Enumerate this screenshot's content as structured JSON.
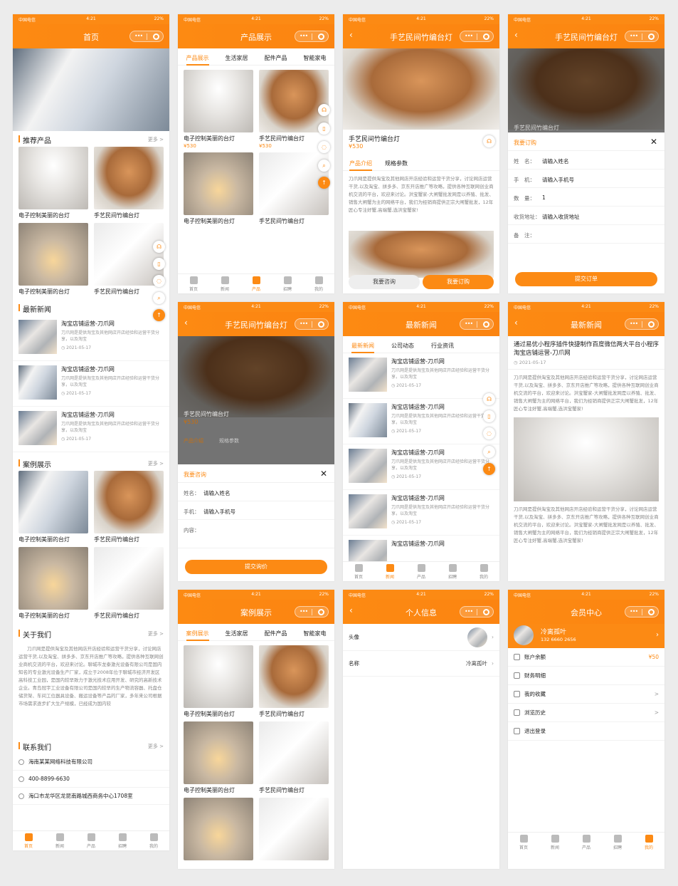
{
  "status": {
    "carrier": "中国电信",
    "time": "4:21",
    "battery": "22%"
  },
  "home": {
    "title": "首页",
    "sec_products": "推荐产品",
    "sec_news": "最新新闻",
    "sec_cases": "案例展示",
    "sec_about": "关于我们",
    "sec_contact": "联系我们",
    "more": "更多 >",
    "products": [
      "电子控制美丽的台灯",
      "手艺民间竹编台灯",
      "电子控制美丽的台灯",
      "手艺民间竹编台灯"
    ],
    "news": [
      {
        "title": "淘宝店铺运营-刀爪网",
        "desc": "刀爪网是提供淘宝及其他网店开店经验和运营干货分享，以及淘宝",
        "date": "2021-05-17"
      },
      {
        "title": "淘宝店铺运营-刀爪网",
        "desc": "刀爪网是提供淘宝及其他网店开店经验和运营干货分享，以及淘宝",
        "date": "2021-05-17"
      },
      {
        "title": "淘宝店铺运营-刀爪网",
        "desc": "刀爪网是提供淘宝及其他网店开店经验和运营干货分享，以及淘宝",
        "date": "2021-05-17"
      }
    ],
    "cases": [
      "电子控制美丽的台灯",
      "手艺民间竹编台灯",
      "电子控制美丽的台灯",
      "手艺民间竹编台灯"
    ],
    "about": "刀爪网是提供淘宝及其他网店开店经验和运营干货分享，讨论网店运营干货,以及淘宝、拼多多、京东开店推广等攻略，提供各种互联网创业商机交流的平台，欢迎来讨论。聊城市龙泰激光设备有限公司是国内知名的专业激光设备生产厂家，成立于2008年位于聊城市经济开发区高科技工业园，是国内较早致力于激光技术应用开发、研究的高新技术企业。青岛冠宇工业设备有限公司是国内较早的生产物流容器、托盘仓储货架、车间工位器具设备、搬运设备等产品的厂家，多年来公司根据市场需求逐步扩大生产规模，已经成为国内较",
    "company": "海南某某网络科技有限公司",
    "phone": "400-8899-6630",
    "address": "海口市龙华区龙昆南路城西商务中心1708室"
  },
  "tabbar": [
    "首页",
    "新闻",
    "产品",
    "招聘",
    "我的"
  ],
  "products_page": {
    "title": "产品展示",
    "tabs": [
      "产品展示",
      "生活家居",
      "配件产品",
      "智能家电"
    ],
    "items": [
      {
        "name": "电子控制美丽的台灯",
        "price": "¥530"
      },
      {
        "name": "手艺民间竹编台灯",
        "price": "¥530"
      },
      {
        "name": "电子控制美丽的台灯",
        "price": ""
      },
      {
        "name": "手艺民间竹编台灯",
        "price": ""
      }
    ]
  },
  "detail": {
    "title": "手艺民间竹编台灯",
    "name": "手艺民间竹编台灯",
    "price": "¥530",
    "tabs": [
      "产品介绍",
      "规格参数"
    ],
    "desc": "刀爪网是提供淘宝及其他网店开店经验和运营干货分享，讨论网店运营干货,以及淘宝、拼多多、京东开店推广等攻略，提供各种互联网创业商机交流的平台，欢迎来讨论。洪宝蟹家-大闸蟹批发网是以养殖、批发、销售大闸蟹为主的网络平台，我们为经销商提供正宗大闸蟹批发，12年匠心专注好蟹,高端蟹,选洪宝蟹家!",
    "consult": "我要咨询",
    "order": "我要订购"
  },
  "order_form": {
    "title": "我要订购",
    "rows": [
      {
        "k": "姓　名：",
        "v": "请输入姓名"
      },
      {
        "k": "手　机：",
        "v": "请输入手机号"
      },
      {
        "k": "数　量：",
        "v": "1"
      },
      {
        "k": "收货地址：",
        "v": "请输入收货地址"
      },
      {
        "k": "备　注：",
        "v": ""
      }
    ],
    "submit": "提交订单"
  },
  "consult_form": {
    "title": "我要咨询",
    "rows": [
      {
        "k": "姓名：",
        "v": "请输入姓名"
      },
      {
        "k": "手机：",
        "v": "请输入手机号"
      },
      {
        "k": "内容：",
        "v": ""
      }
    ],
    "submit": "提交询价"
  },
  "news_page": {
    "title": "最新新闻",
    "tabs": [
      "最新新闻",
      "公司动态",
      "行业资讯"
    ],
    "items": [
      {
        "title": "淘宝店铺运营-刀爪网",
        "desc": "刀爪网是提供淘宝及其他网店开店经验和运营干货分享，以及淘宝",
        "date": "2021-05-17"
      },
      {
        "title": "淘宝店铺运营-刀爪网",
        "desc": "刀爪网是提供淘宝及其他网店开店经验和运营干货分享，以及淘宝",
        "date": "2021-05-17"
      },
      {
        "title": "淘宝店铺运营-刀爪网",
        "desc": "刀爪网是提供淘宝及其他网店开店经验和运营干货分享，以及淘宝",
        "date": "2021-05-17"
      },
      {
        "title": "淘宝店铺运营-刀爪网",
        "desc": "刀爪网是提供淘宝及其他网店开店经验和运营干货分享，以及淘宝",
        "date": "2021-05-17"
      },
      {
        "title": "淘宝店铺运营-刀爪网",
        "desc": "",
        "date": ""
      }
    ]
  },
  "article": {
    "title": "最新新闻",
    "heading": "通过易优小程序插件快捷制作百度微信两大平台小程序淘宝店铺运营-刀爪网",
    "date": "2021-05-17",
    "body": "刀爪网是提供淘宝及其他网店开店经验和运营干货分享，讨论网店运营干货,以及淘宝、拼多多、京东开店推广等攻略，提供各种互联网创业商机交流的平台，欢迎来讨论。洪宝蟹家-大闸蟹批发网是以养殖、批发、销售大闸蟹为主的网络平台，我们为经销商提供正宗大闸蟹批发，12年匠心专注好蟹,高端蟹,选洪宝蟹家!"
  },
  "cases_page": {
    "title": "案例展示",
    "tabs": [
      "案例展示",
      "生活家居",
      "配件产品",
      "智能家电"
    ],
    "items": [
      "电子控制美丽的台灯",
      "手艺民间竹编台灯",
      "电子控制美丽的台灯",
      "手艺民间竹编台灯"
    ]
  },
  "profile": {
    "title": "个人信息",
    "avatar_label": "头像",
    "name_label": "名称",
    "name": "冷离孤叶"
  },
  "member": {
    "title": "会员中心",
    "user": "冷离孤叶",
    "phone": "132 6660 2656",
    "rows": [
      {
        "label": "账户余额",
        "value": "¥50"
      },
      {
        "label": "财务明细",
        "value": ""
      },
      {
        "label": "我的收藏",
        "value": ">"
      },
      {
        "label": "浏览历史",
        "value": ">"
      },
      {
        "label": "退出登录",
        "value": ""
      }
    ]
  },
  "accent": "#fc8a14"
}
